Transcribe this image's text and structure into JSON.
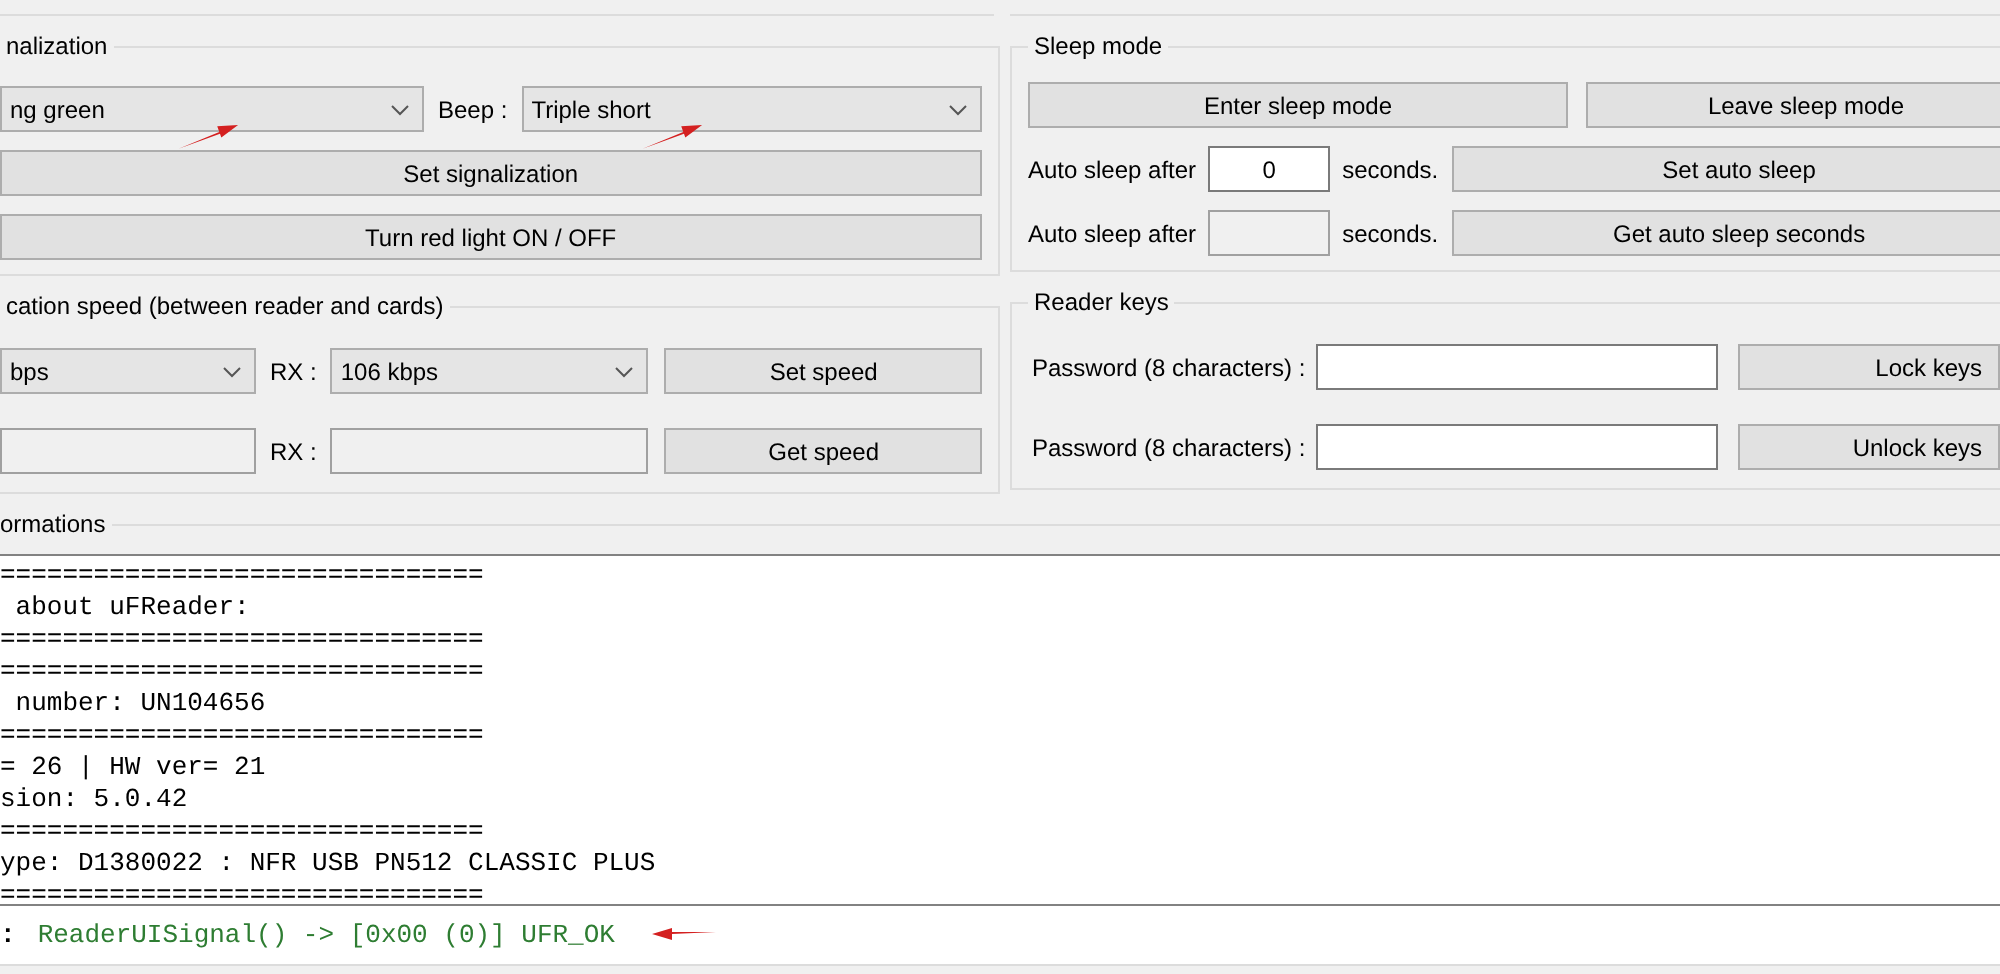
{
  "signalization": {
    "title": "nalization",
    "light_mode": "ng green",
    "beep_label": "Beep :",
    "beep_mode": "Triple short",
    "buttons": [
      "Set signalization",
      "Turn red light ON / OFF"
    ]
  },
  "speed": {
    "title": "cation speed (between reader and cards)",
    "tx_value": "bps",
    "rx_label": "RX :",
    "rx_value": "106 kbps",
    "set_button": "Set speed",
    "rx_label_2": "RX :",
    "get_button": "Get speed"
  },
  "sleep_mode": {
    "title": "Sleep mode",
    "enter_button": "Enter sleep mode",
    "leave_button": "Leave sleep mode",
    "rows": [
      {
        "label": "Auto sleep after",
        "value": "0",
        "disabled": false,
        "unit": "seconds.",
        "button": "Set auto sleep"
      },
      {
        "label": "Auto sleep after",
        "disabled": true,
        "unit": "seconds.",
        "button": "Get auto sleep seconds"
      }
    ]
  },
  "reader_keys": {
    "title": "Reader keys",
    "rows": [
      {
        "label": "Password (8 characters) :",
        "button": "Lock keys"
      },
      {
        "label": "Password (8 characters) :",
        "button": "Unlock keys"
      }
    ]
  },
  "informations": {
    "title": "ormations",
    "log_lines": [
      "===============================",
      " about uFReader:",
      "===============================",
      "===============================",
      " number: UN104656",
      "===============================",
      "= 26 | HW ver= 21",
      "sion: 5.0.42",
      "===============================",
      "ype: D1380022 : NFR USB PN512 CLASSIC PLUS",
      "==============================="
    ],
    "status": {
      "prefix": ":",
      "message": "ReaderUISignal() -> [0x00 (0)] UFR_OK"
    }
  }
}
